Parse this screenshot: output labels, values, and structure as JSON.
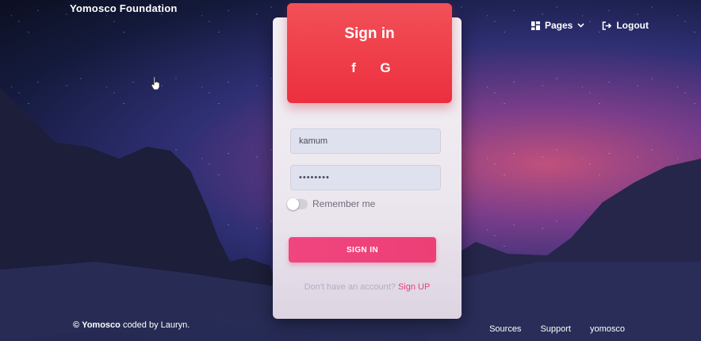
{
  "navbar": {
    "brand": "Yomosco Foundation",
    "pages_label": "Pages",
    "logout_label": "Logout"
  },
  "login_card": {
    "title": "Sign in",
    "social": [
      {
        "name": "facebook",
        "glyph": "f"
      },
      {
        "name": "google",
        "glyph": "G"
      }
    ],
    "username_value": "kamum",
    "password_value": "••••••••",
    "remember_label": "Remember me",
    "remember_checked": false,
    "submit_label": "SIGN IN",
    "signup_prompt": "Don't have an account?",
    "signup_link": "Sign UP"
  },
  "footer": {
    "copyright_symbol": "©",
    "copyright_brand": "Yomosco",
    "copyright_rest": "coded by Lauryn.",
    "links": [
      "Sources",
      "Support",
      "yomosco"
    ]
  },
  "colors": {
    "header_red": "#ec2f3e",
    "button_pink": "#ec3f76",
    "link_pink": "#e63f78"
  }
}
